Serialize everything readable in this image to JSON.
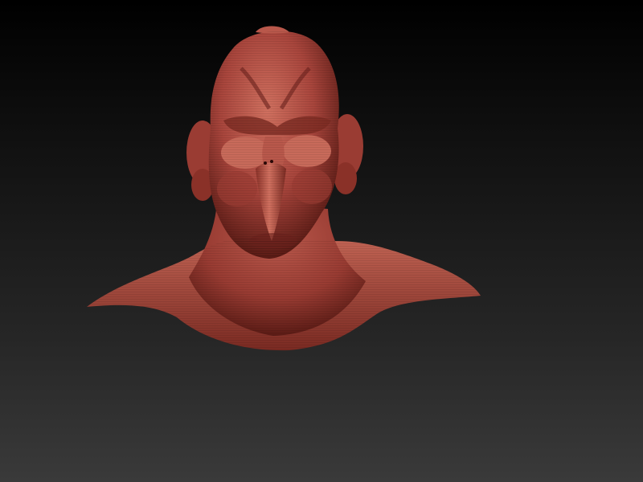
{
  "viewport": {
    "background_top": "#000000",
    "background_bottom": "#3a3a3a"
  },
  "model": {
    "icon": "sculpted-bust",
    "material_color": "#a8453c",
    "shadow_color": "#4a1410",
    "highlight_color": "#d0705f"
  }
}
